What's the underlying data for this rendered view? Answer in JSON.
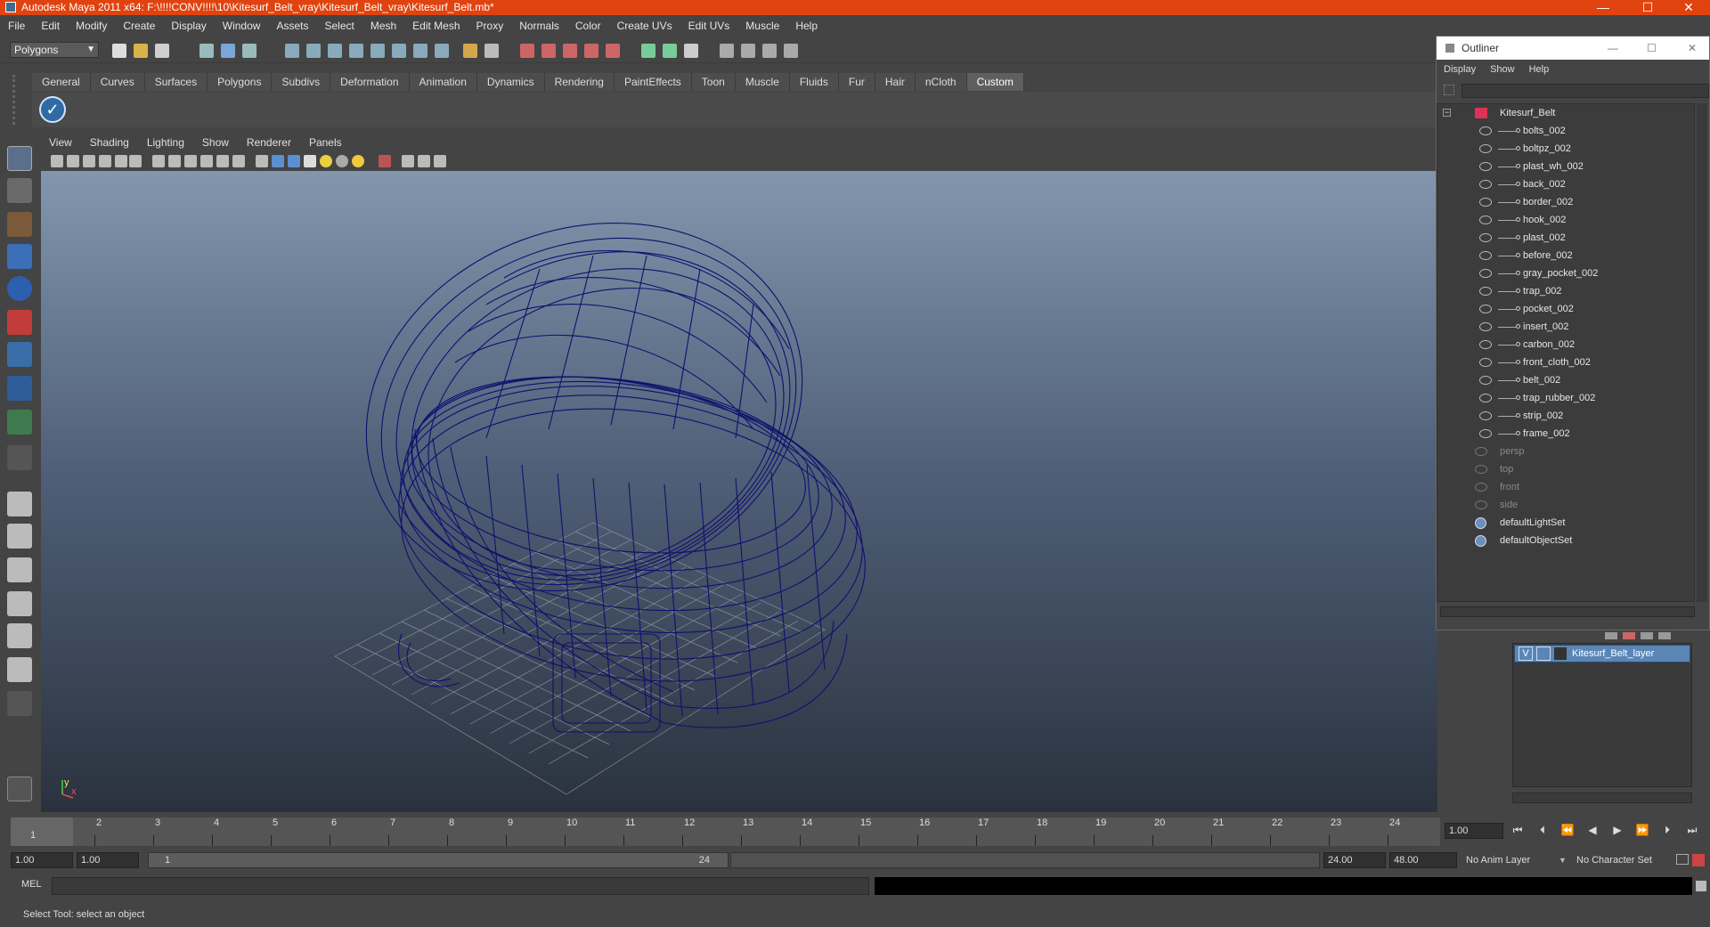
{
  "window": {
    "title": "Autodesk Maya 2011 x64: F:\\!!!!CONV!!!!\\10\\Kitesurf_Belt_vray\\Kitesurf_Belt_vray\\Kitesurf_Belt.mb*",
    "minimize": "—",
    "maximize": "☐",
    "close": "✕"
  },
  "menubar": [
    "File",
    "Edit",
    "Modify",
    "Create",
    "Display",
    "Window",
    "Assets",
    "Select",
    "Mesh",
    "Edit Mesh",
    "Proxy",
    "Normals",
    "Color",
    "Create UVs",
    "Edit UVs",
    "Muscle",
    "Help"
  ],
  "toolbar": {
    "mode_selector": "Polygons"
  },
  "shelf": {
    "tabs": [
      "General",
      "Curves",
      "Surfaces",
      "Polygons",
      "Subdivs",
      "Deformation",
      "Animation",
      "Dynamics",
      "Rendering",
      "PaintEffects",
      "Toon",
      "Muscle",
      "Fluids",
      "Fur",
      "Hair",
      "nCloth",
      "Custom"
    ],
    "active_tab": "Custom",
    "checkmark_glyph": "✓"
  },
  "viewport": {
    "menu": [
      "View",
      "Shading",
      "Lighting",
      "Show",
      "Renderer",
      "Panels"
    ],
    "axis_y": "y",
    "axis_x": "x"
  },
  "timeline": {
    "labels": [
      "1",
      "2",
      "3",
      "4",
      "5",
      "6",
      "7",
      "8",
      "9",
      "10",
      "11",
      "12",
      "13",
      "14",
      "15",
      "16",
      "17",
      "18",
      "19",
      "20",
      "21",
      "22",
      "23",
      "24"
    ],
    "current_frame": "1.00",
    "current_marker": "1"
  },
  "playback": {
    "go_start": "⏮",
    "step_back": "⏴",
    "prev_key": "⏪",
    "play_back": "◀",
    "play_fwd": "▶",
    "next_key": "⏩",
    "step_fwd": "⏵",
    "go_end": "⏭"
  },
  "range": {
    "start_time": "1.00",
    "playback_start": "1.00",
    "slider_start": "1",
    "slider_end": "24",
    "playback_end": "24.00",
    "end_time": "48.00",
    "anim_layer": "No Anim Layer",
    "character_set": "No Character Set"
  },
  "command_line": {
    "label": "MEL"
  },
  "help_line": "Select Tool: select an object",
  "outliner": {
    "title": "Outliner",
    "menu": [
      "Display",
      "Show",
      "Help"
    ],
    "root": "Kitesurf_Belt",
    "children": [
      "bolts_002",
      "boltpz_002",
      "plast_wh_002",
      "back_002",
      "border_002",
      "hook_002",
      "plast_002",
      "before_002",
      "gray_pocket_002",
      "trap_002",
      "pocket_002",
      "insert_002",
      "carbon_002",
      "front_cloth_002",
      "belt_002",
      "trap_rubber_002",
      "strip_002",
      "frame_002"
    ],
    "cameras": [
      "persp",
      "top",
      "front",
      "side"
    ],
    "sets": [
      "defaultLightSet",
      "defaultObjectSet"
    ]
  },
  "layers": {
    "visible_flag": "V",
    "layer_name": "Kitesurf_Belt_layer"
  },
  "colors": {
    "title_bar": "#e0430f",
    "wireframe": "#10106e",
    "layer_selected": "#5a86b6"
  }
}
